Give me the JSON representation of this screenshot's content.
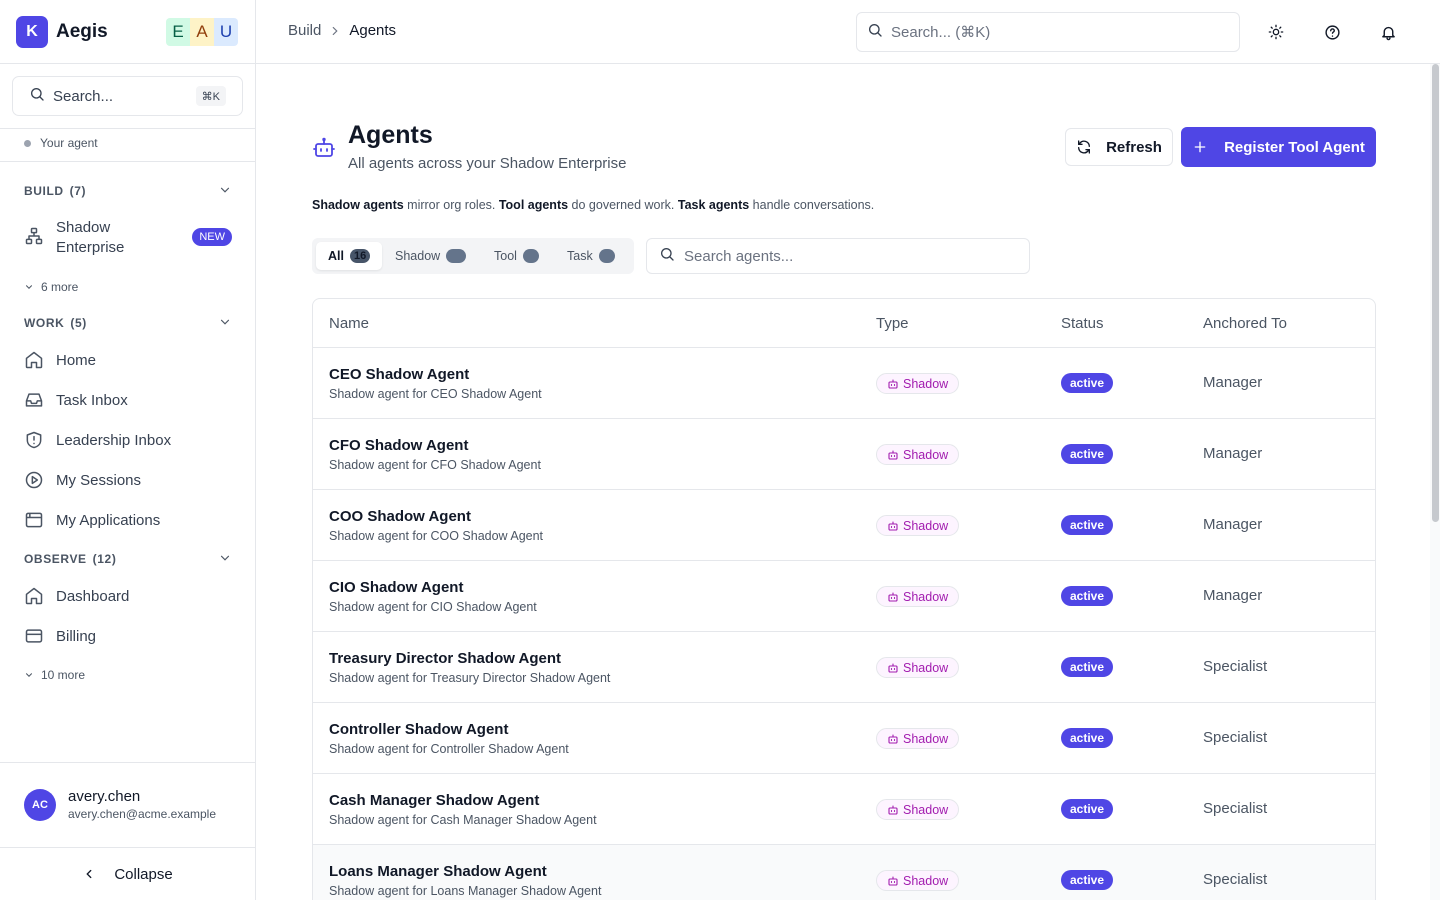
{
  "brand": {
    "logo_letter": "K",
    "name": "Aegis",
    "letters": [
      "E",
      "A",
      "U"
    ]
  },
  "sidebar": {
    "search_placeholder": "Search...",
    "search_shortcut": "⌘K",
    "your_agent": "Your agent",
    "sections": [
      {
        "title": "BUILD",
        "count": "(7)",
        "items": [
          {
            "label": "Shadow Enterprise",
            "badge": "NEW",
            "icon": "org-chart-icon"
          }
        ],
        "more": "6 more"
      },
      {
        "title": "WORK",
        "count": "(5)",
        "items": [
          {
            "label": "Home",
            "icon": "home-icon"
          },
          {
            "label": "Task Inbox",
            "icon": "inbox-icon"
          },
          {
            "label": "Leadership Inbox",
            "icon": "shield-alert-icon"
          },
          {
            "label": "My Sessions",
            "icon": "play-circle-icon"
          },
          {
            "label": "My Applications",
            "icon": "browser-window-icon"
          }
        ]
      },
      {
        "title": "OBSERVE",
        "count": "(12)",
        "items": [
          {
            "label": "Dashboard",
            "icon": "home-icon"
          },
          {
            "label": "Billing",
            "icon": "credit-card-icon"
          }
        ],
        "more": "10 more"
      }
    ],
    "user": {
      "initials": "AC",
      "name": "avery.chen",
      "email": "avery.chen@acme.example"
    },
    "collapse_label": "Collapse"
  },
  "topbar": {
    "breadcrumb": [
      "Build",
      "Agents"
    ],
    "search_placeholder": "Search... (⌘K)",
    "icons": [
      "sun-icon",
      "help-circle-icon",
      "bell-icon"
    ]
  },
  "page": {
    "title": "Agents",
    "subtitle": "All agents across your Shadow Enterprise",
    "refresh_label": "Refresh",
    "register_label": "Register Tool Agent",
    "description": [
      {
        "bold": "Shadow agents",
        "text": " mirror org roles. "
      },
      {
        "bold": "Tool agents",
        "text": " do governed work. "
      },
      {
        "bold": "Task agents",
        "text": " handle conversations."
      }
    ],
    "filters": [
      {
        "label": "All",
        "count": "16"
      },
      {
        "label": "Shadow",
        "count": ""
      },
      {
        "label": "Tool",
        "count": ""
      },
      {
        "label": "Task",
        "count": ""
      }
    ],
    "agent_search_placeholder": "Search agents...",
    "accent_color": "#4f46e5"
  },
  "table": {
    "columns": [
      "Name",
      "Type",
      "Status",
      "Anchored To"
    ],
    "rows": [
      {
        "name": "CEO Shadow Agent",
        "sub": "Shadow agent for CEO Shadow Agent",
        "type": "Shadow",
        "status": "active",
        "anchored": "Manager"
      },
      {
        "name": "CFO Shadow Agent",
        "sub": "Shadow agent for CFO Shadow Agent",
        "type": "Shadow",
        "status": "active",
        "anchored": "Manager"
      },
      {
        "name": "COO Shadow Agent",
        "sub": "Shadow agent for COO Shadow Agent",
        "type": "Shadow",
        "status": "active",
        "anchored": "Manager"
      },
      {
        "name": "CIO Shadow Agent",
        "sub": "Shadow agent for CIO Shadow Agent",
        "type": "Shadow",
        "status": "active",
        "anchored": "Manager"
      },
      {
        "name": "Treasury Director Shadow Agent",
        "sub": "Shadow agent for Treasury Director Shadow Agent",
        "type": "Shadow",
        "status": "active",
        "anchored": "Specialist"
      },
      {
        "name": "Controller Shadow Agent",
        "sub": "Shadow agent for Controller Shadow Agent",
        "type": "Shadow",
        "status": "active",
        "anchored": "Specialist"
      },
      {
        "name": "Cash Manager Shadow Agent",
        "sub": "Shadow agent for Cash Manager Shadow Agent",
        "type": "Shadow",
        "status": "active",
        "anchored": "Specialist"
      },
      {
        "name": "Loans Manager Shadow Agent",
        "sub": "Shadow agent for Loans Manager Shadow Agent",
        "type": "Shadow",
        "status": "active",
        "anchored": "Specialist"
      }
    ]
  }
}
